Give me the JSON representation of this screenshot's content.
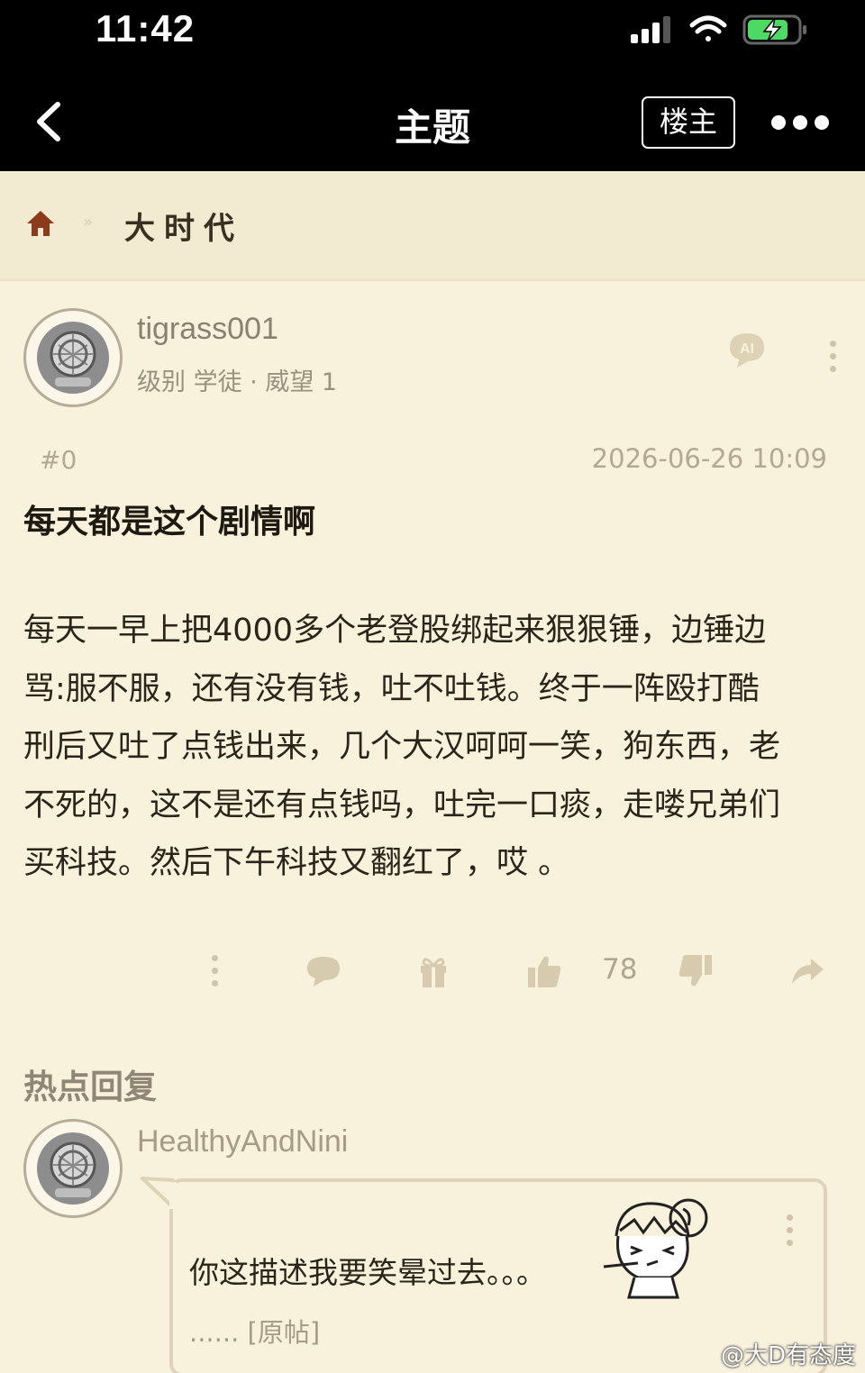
{
  "status_bar": {
    "time": "11:42"
  },
  "nav": {
    "title": "主题",
    "owner_button": "楼主"
  },
  "breadcrumb": {
    "separator": "»",
    "forum": "大时代"
  },
  "post": {
    "author": "tigrass001",
    "author_meta": "级别 学徒 · 威望 1",
    "ai_label": "AI",
    "floor": "#0",
    "time": "2026-06-26 10:09",
    "title": "每天都是这个剧情啊",
    "body_lines": [
      "每天一早上把4000多个老登股绑起来狠狠锤，边锤边",
      "骂:服不服，还有没有钱，吐不吐钱。终于一阵殴打酷",
      "刑后又吐了点钱出来，几个大汉呵呵一笑，狗东西，老",
      "不死的，这不是还有点钱吗，吐完一口痰，走喽兄弟们",
      "买科技。然后下午科技又翻红了，哎 。"
    ],
    "like_count": "78"
  },
  "hot_replies": {
    "title": "热点回复",
    "items": [
      {
        "user": "HealthyAndNini",
        "text": "你这描述我要笑晕过去。。。",
        "more": "...... [原帖]"
      }
    ]
  },
  "watermark": "@大D有态度",
  "colors": {
    "background": "#f8f1db",
    "header": "#000000",
    "icon_muted": "#cfc4aa",
    "home_icon": "#8b3a1c"
  },
  "icons": [
    "signal-icon",
    "wifi-icon",
    "battery-charging-icon",
    "back-icon",
    "more-dots-icon",
    "home-icon",
    "ai-chat-icon",
    "comment-icon",
    "gift-icon",
    "thumbs-up-icon",
    "thumbs-down-icon",
    "share-icon"
  ]
}
